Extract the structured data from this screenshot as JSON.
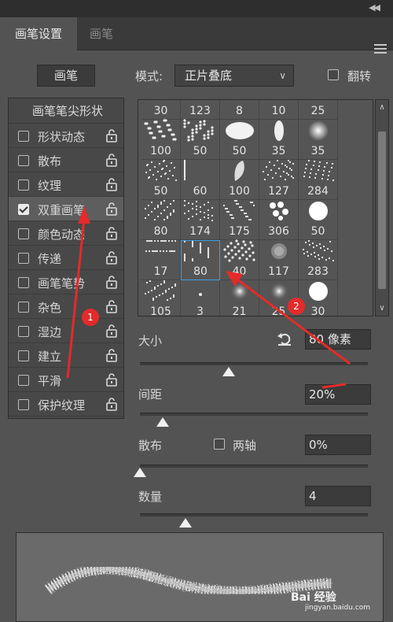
{
  "tabs": [
    {
      "label": "画笔设置",
      "active": true
    },
    {
      "label": "画笔",
      "active": false
    }
  ],
  "toolbar": {
    "brush_button": "画笔",
    "mode_label": "模式:",
    "mode_value": "正片叠底",
    "flip_label": "翻转",
    "flip_checked": false
  },
  "left_panel": {
    "tip_header": "画笔笔尖形状",
    "items": [
      {
        "label": "形状动态",
        "checked": false,
        "selected": false
      },
      {
        "label": "散布",
        "checked": false,
        "selected": false
      },
      {
        "label": "纹理",
        "checked": false,
        "selected": false
      },
      {
        "label": "双重画笔",
        "checked": true,
        "selected": true
      },
      {
        "label": "颜色动态",
        "checked": false,
        "selected": false
      },
      {
        "label": "传递",
        "checked": false,
        "selected": false
      },
      {
        "label": "画笔笔势",
        "checked": false,
        "selected": false
      },
      {
        "label": "杂色",
        "checked": false,
        "selected": false
      },
      {
        "label": "湿边",
        "checked": false,
        "selected": false
      },
      {
        "label": "建立",
        "checked": false,
        "selected": false
      },
      {
        "label": "平滑",
        "checked": false,
        "selected": false
      },
      {
        "label": "保护纹理",
        "checked": false,
        "selected": false
      }
    ]
  },
  "brush_grid": {
    "rows": [
      [
        "30",
        "123",
        "8",
        "10",
        "25"
      ],
      [
        "100",
        "50",
        "50",
        "35",
        "35"
      ],
      [
        "50",
        "60",
        "100",
        "127",
        "284"
      ],
      [
        "80",
        "174",
        "175",
        "306",
        "50"
      ],
      [
        "17",
        "80",
        "40",
        "117",
        "283"
      ],
      [
        "105",
        "3",
        "21",
        "25",
        "30"
      ]
    ],
    "selected_index": 21
  },
  "settings": {
    "size_label": "大小",
    "size_value": "80 像素",
    "size_fraction": 0.39,
    "spacing_label": "间距",
    "spacing_value": "20%",
    "spacing_fraction": 0.1,
    "scatter_label": "散布",
    "both_axes_label": "两轴",
    "both_axes_checked": false,
    "scatter_value": "0%",
    "scatter_fraction": 0.0,
    "count_label": "数量",
    "count_value": "4",
    "count_fraction": 0.2
  },
  "annotations": {
    "badge_1": "1",
    "badge_2": "2",
    "color": "#e32b2b"
  },
  "watermark": {
    "text": "Bai 经验",
    "sub": "jingyan.baidu.com"
  }
}
